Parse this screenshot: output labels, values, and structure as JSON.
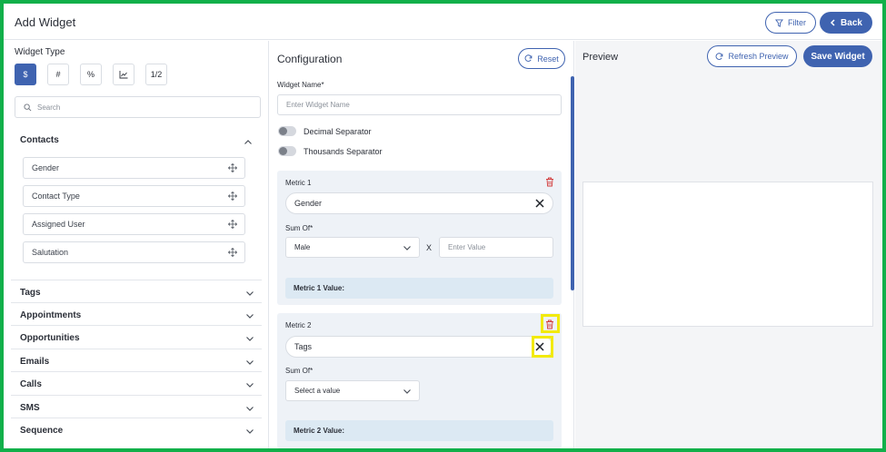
{
  "header": {
    "title": "Add Widget",
    "filter_label": "Filter",
    "back_label": "Back"
  },
  "left": {
    "widget_type_label": "Widget Type",
    "type_buttons": [
      "$",
      "#",
      "%",
      "⟋",
      "1/2"
    ],
    "search_placeholder": "Search",
    "contacts": {
      "title": "Contacts",
      "fields": [
        "Gender",
        "Contact Type",
        "Assigned User",
        "Salutation"
      ]
    },
    "sections": [
      "Tags",
      "Appointments",
      "Opportunities",
      "Emails",
      "Calls",
      "SMS",
      "Sequence"
    ]
  },
  "config": {
    "title": "Configuration",
    "reset_label": "Reset",
    "widget_name_label": "Widget Name*",
    "widget_name_placeholder": "Enter Widget Name",
    "decimal_separator": "Decimal Separator",
    "thousands_separator": "Thousands Separator",
    "metrics": [
      {
        "title": "Metric 1",
        "field": "Gender",
        "sum_of_label": "Sum Of*",
        "sum_of_value": "Male",
        "multiplier_symbol": "X",
        "value_placeholder": "Enter Value",
        "value_label": "Metric 1 Value:"
      },
      {
        "title": "Metric 2",
        "field": "Tags",
        "sum_of_label": "Sum Of*",
        "sum_of_value": "Select a value",
        "value_label": "Metric 2 Value:"
      }
    ]
  },
  "preview": {
    "title": "Preview",
    "refresh_label": "Refresh Preview",
    "save_label": "Save Widget"
  },
  "colors": {
    "accent": "#3f63b0",
    "frame_border": "#11b04a",
    "highlight": "#f2ea0a",
    "danger": "#d23b3b"
  }
}
